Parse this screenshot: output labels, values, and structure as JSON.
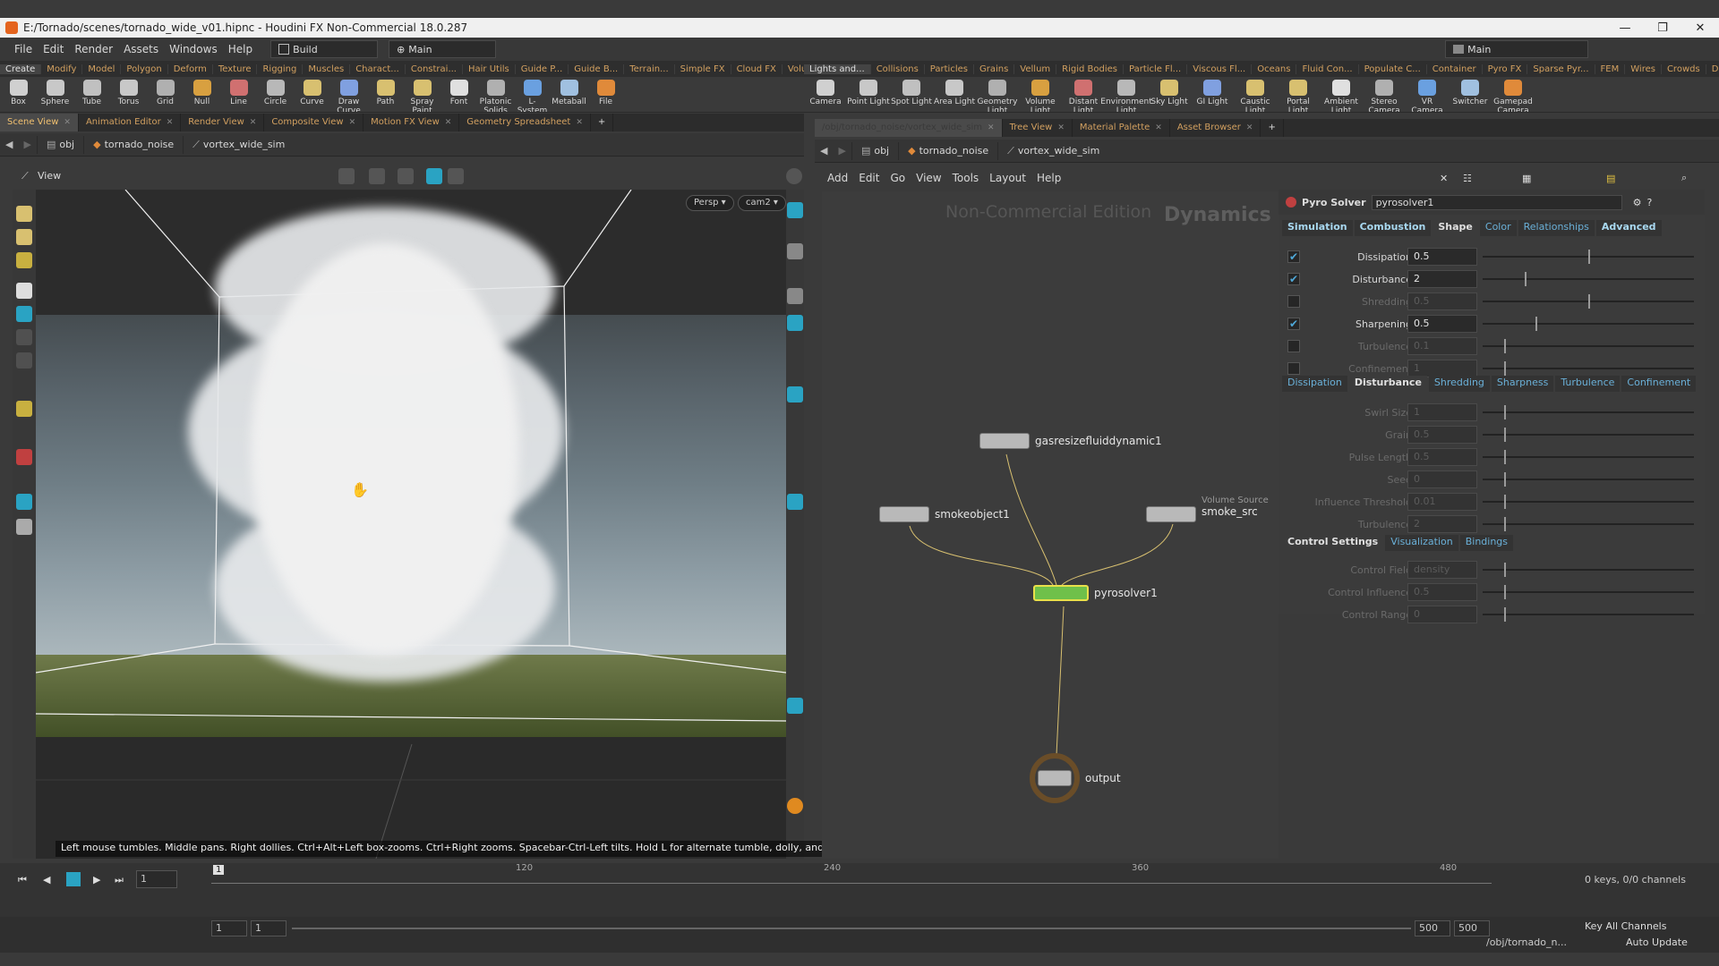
{
  "window": {
    "title": "E:/Tornado/scenes/tornado_wide_v01.hipnc - Houdini FX Non-Commercial 18.0.287",
    "min": "—",
    "max": "❐",
    "close": "✕"
  },
  "menubar": {
    "items": [
      "File",
      "Edit",
      "Render",
      "Assets",
      "Windows",
      "Help"
    ],
    "desktop_left": "Build",
    "desktop_main": "Main",
    "desktop_right": "Main"
  },
  "shelf_tabs_left": [
    "Create",
    "Modify",
    "Model",
    "Polygon",
    "Deform",
    "Texture",
    "Rigging",
    "Muscles",
    "Charact...",
    "Constrai...",
    "Hair Utils",
    "Guide P...",
    "Guide B...",
    "Terrain...",
    "Simple FX",
    "Cloud FX",
    "Volume",
    "+"
  ],
  "shelf_tabs_right": [
    "Lights and...",
    "Collisions",
    "Particles",
    "Grains",
    "Vellum",
    "Rigid Bodies",
    "Particle Fl...",
    "Viscous Fl...",
    "Oceans",
    "Fluid Con...",
    "Populate C...",
    "Container",
    "Pyro FX",
    "Sparse Pyr...",
    "FEM",
    "Wires",
    "Crowds",
    "Drive Sim...",
    "+"
  ],
  "shelf_tools_left": [
    "Box",
    "Sphere",
    "Tube",
    "Torus",
    "Grid",
    "Null",
    "Line",
    "Circle",
    "Curve",
    "Draw Curve",
    "Path",
    "Spray Paint",
    "Font",
    "Platonic Solids",
    "L-System",
    "Metaball",
    "File"
  ],
  "shelf_tools_right": [
    "Camera",
    "Point Light",
    "Spot Light",
    "Area Light",
    "Geometry Light",
    "Volume Light",
    "Distant Light",
    "Environment Light",
    "Sky Light",
    "GI Light",
    "Caustic Light",
    "Portal Light",
    "Ambient Light",
    "Stereo Camera",
    "VR Camera",
    "Switcher",
    "Gamepad Camera"
  ],
  "left_pane": {
    "tabs": [
      "Scene View",
      "Animation Editor",
      "Render View",
      "Composite View",
      "Motion FX View",
      "Geometry Spreadsheet"
    ],
    "path": [
      "obj",
      "tornado_noise",
      "vortex_wide_sim"
    ],
    "view_label": "View",
    "persp": "Persp ▾",
    "cam": "cam2 ▾",
    "hint": "Left mouse tumbles. Middle pans. Right dollies. Ctrl+Alt+Left box-zooms. Ctrl+Right zooms. Spacebar-Ctrl-Left tilts. Hold L for alternate tumble, dolly, and zoom."
  },
  "right_pane": {
    "tabs": [
      "/obj/tornado_noise/vortex_wide_sim",
      "Tree View",
      "Material Palette",
      "Asset Browser"
    ],
    "path": [
      "obj",
      "tornado_noise",
      "vortex_wide_sim"
    ],
    "menu": [
      "Add",
      "Edit",
      "Go",
      "View",
      "Tools",
      "Layout",
      "Help"
    ],
    "watermark_edition": "Non-Commercial Edition",
    "watermark_context": "Dynamics"
  },
  "nodes": {
    "gasresize": "gasresizefluiddynamic1",
    "smokeobject": "smokeobject1",
    "volume_source_type": "Volume Source",
    "smoke_src": "smoke_src",
    "pyrosolver": "pyrosolver1",
    "output": "output"
  },
  "params": {
    "node_type": "Pyro Solver",
    "node_name": "pyrosolver1",
    "main_tabs": [
      "Simulation",
      "Combustion",
      "Shape",
      "Color",
      "Relationships",
      "Advanced"
    ],
    "rows": [
      {
        "label": "Dissipation",
        "value": "0.5",
        "checked": true,
        "enabled": true,
        "level": 0.5
      },
      {
        "label": "Disturbance",
        "value": "2",
        "checked": true,
        "enabled": true,
        "level": 0.2
      },
      {
        "label": "Shredding",
        "value": "0.5",
        "checked": false,
        "enabled": false,
        "level": 0.5
      },
      {
        "label": "Sharpening",
        "value": "0.5",
        "checked": true,
        "enabled": true,
        "level": 0.25
      },
      {
        "label": "Turbulence",
        "value": "0.1",
        "checked": false,
        "enabled": false,
        "level": 0.1
      },
      {
        "label": "Confinement",
        "value": "1",
        "checked": false,
        "enabled": false,
        "level": 0.1
      }
    ],
    "sub_tabs": [
      "Dissipation",
      "Disturbance",
      "Shredding",
      "Sharpness",
      "Turbulence",
      "Confinement"
    ],
    "sub_rows": [
      {
        "label": "Swirl Size",
        "value": "1"
      },
      {
        "label": "Grain",
        "value": "0.5"
      },
      {
        "label": "Pulse Length",
        "value": "0.5"
      },
      {
        "label": "Seed",
        "value": "0"
      },
      {
        "label": "Influence Threshold",
        "value": "0.01"
      },
      {
        "label": "Turbulence",
        "value": "2"
      }
    ],
    "ctrl_tabs": [
      "Control Settings",
      "Visualization",
      "Bindings"
    ],
    "ctrl_rows": [
      {
        "label": "Control Field",
        "value": "density"
      },
      {
        "label": "Control Influence",
        "value": "0.5"
      },
      {
        "label": "Control Range",
        "value": "0"
      }
    ]
  },
  "timeline": {
    "current_frame": "1",
    "frame_field": "1",
    "ticks": [
      "120",
      "240",
      "360",
      "480"
    ],
    "start": "1",
    "start2": "1",
    "end": "500",
    "end2": "500",
    "keys_info": "0 keys, 0/0 channels",
    "key_all": "Key All Channels"
  },
  "status": {
    "path": "/obj/tornado_n...",
    "auto_update": "Auto Update"
  }
}
